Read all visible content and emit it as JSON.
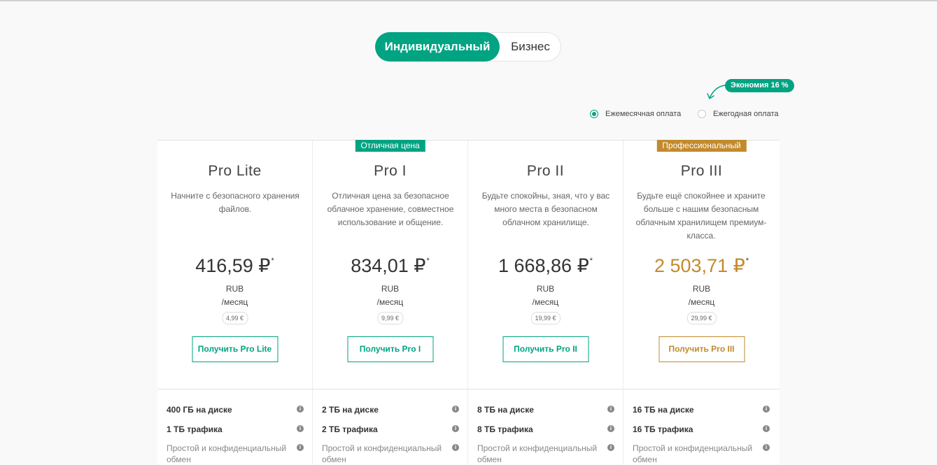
{
  "toggle": {
    "individual": "Индивидуальный",
    "business": "Бизнес"
  },
  "savings_badge": "Экономия 16 %",
  "billing": {
    "monthly": "Ежемесячная оплата",
    "yearly": "Ежегодная оплата",
    "selected": "monthly"
  },
  "colors": {
    "accent": "#00a382",
    "gold": "#c28a2c",
    "text": "#333333"
  },
  "plans": [
    {
      "name": "Pro Lite",
      "badge": "",
      "description": "Начните с безопасного хранения файлов.",
      "price": "416,59 ₽",
      "price_mark": "*",
      "currency": "RUB",
      "period": "/месяц",
      "eur": "4,99 €",
      "button": "Получить Pro Lite",
      "features": [
        "400 ГБ на диске",
        "1 ТБ трафика",
        "Простой и конфиденциальный обмен"
      ]
    },
    {
      "name": "Pro I",
      "badge": "Отличная цена",
      "description": "Отличная цена за безопасное облачное хранение, совместное использование и общение.",
      "price": "834,01 ₽",
      "price_mark": "*",
      "currency": "RUB",
      "period": "/месяц",
      "eur": "9,99 €",
      "button": "Получить Pro I",
      "features": [
        "2 ТБ на диске",
        "2 ТБ трафика",
        "Простой и конфиденциальный обмен"
      ]
    },
    {
      "name": "Pro II",
      "badge": "",
      "description": "Будьте спокойны, зная, что у вас много места в безопасном облачном хранилище.",
      "price": "1 668,86 ₽",
      "price_mark": "*",
      "currency": "RUB",
      "period": "/месяц",
      "eur": "19,99 €",
      "button": "Получить Pro II",
      "features": [
        "8 ТБ на диске",
        "8 ТБ трафика",
        "Простой и конфиденциальный обмен"
      ]
    },
    {
      "name": "Pro III",
      "badge": "Профессиональный",
      "description": "Будьте ещё спокойнее и храните больше с нашим безопасным облачным хранилищем премиум-класса.",
      "price": "2 503,71 ₽",
      "price_mark": "*",
      "currency": "RUB",
      "period": "/месяц",
      "eur": "29,99 €",
      "button": "Получить Pro III",
      "features": [
        "16 ТБ на диске",
        "16 ТБ трафика",
        "Простой и конфиденциальный обмен"
      ]
    }
  ]
}
